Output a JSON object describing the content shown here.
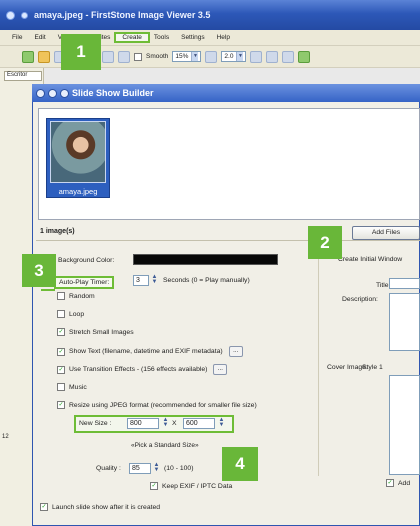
{
  "app": {
    "title": "amaya.jpeg - FirstStone Image Viewer 3.5",
    "menu": [
      "File",
      "Edit",
      "View",
      "Favorites",
      "Create",
      "Tools",
      "Settings",
      "Help"
    ],
    "active_menu": "Create",
    "toolbar": {
      "smooth_label": "Smooth",
      "zoom_value": "15%",
      "ratio_value": "2.0"
    },
    "explorer_tab": "Escritor",
    "explorer_count": "12"
  },
  "dialog": {
    "title": "Slide Show Builder",
    "thumbnail_caption": "amaya.jpeg",
    "image_count": "1 image(s)",
    "background_color_label": "Background Color:",
    "autoplay_label": "Auto-Play Timer:",
    "autoplay_value": "3",
    "autoplay_hint": "Seconds (0 = Play  manually)",
    "options": [
      {
        "label": "Random",
        "checked": false
      },
      {
        "label": "Loop",
        "checked": false
      },
      {
        "label": "Stretch Small Images",
        "checked": true
      },
      {
        "label": "Show Text  (filename, datetime and EXIF metadata)",
        "checked": true
      },
      {
        "label": "Use Transition Effects   -   (156 effects available)",
        "checked": true
      },
      {
        "label": "Music",
        "checked": false
      },
      {
        "label": "Resize using JPEG format (recommended for smaller file size)",
        "checked": true
      }
    ],
    "dots_label": "...",
    "new_size_label": "New Size :",
    "width_value": "800",
    "size_separator": "X",
    "height_value": "600",
    "standard_size": "«Pick a Standard Size»",
    "quality_label": "Quality :",
    "quality_value": "85",
    "quality_hint": "(10 - 100)",
    "keep_exif_label": "Keep EXIF / IPTC Data",
    "launch_label": "Launch slide show after it is created",
    "add_files_label": "Add Files",
    "create_initial_label": "Create Initial Window",
    "title_label": "Title:",
    "description_label": "Description:",
    "cover_image_label": "Cover Image:",
    "cover_image_value": "Style 1",
    "add_right_label": "Add"
  },
  "badges": [
    "1",
    "2",
    "3",
    "4"
  ],
  "colors": {
    "badge_green": "#69b739",
    "title_blue": "#2d58b8",
    "background_swatch": "#080808"
  }
}
